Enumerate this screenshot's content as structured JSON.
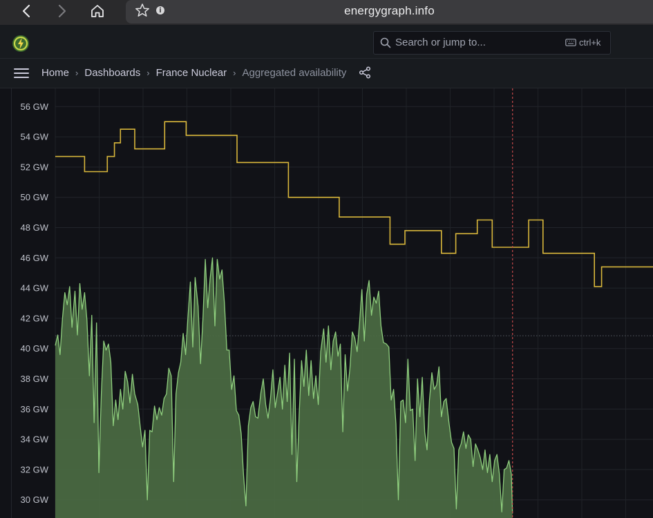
{
  "browser": {
    "url": "energygraph.info",
    "back_icon": "chevron-left-icon",
    "forward_icon": "chevron-right-icon",
    "home_icon": "home-icon"
  },
  "topbar": {
    "search_placeholder": "Search or jump to...",
    "shortcut": "ctrl+k"
  },
  "breadcrumb": {
    "items": [
      "Home",
      "Dashboards",
      "France Nuclear",
      "Aggregated availability"
    ]
  },
  "colors": {
    "availability_line": "#d9b73b",
    "production_fill": "#4b6b43",
    "production_line": "#8fcf7e",
    "now_marker": "#c84a4a"
  },
  "chart_data": {
    "type": "line",
    "y_unit": "GW",
    "yticks": [
      "56 GW",
      "54 GW",
      "52 GW",
      "50 GW",
      "48 GW",
      "46 GW",
      "44 GW",
      "42 GW",
      "40 GW",
      "38 GW",
      "36 GW",
      "34 GW",
      "32 GW",
      "30 GW"
    ],
    "ylim": [
      28.8,
      57.2
    ],
    "xlim": [
      0,
      100
    ],
    "grid": true,
    "threshold_line": 40.85,
    "now_marker_x": 76.5,
    "series": [
      {
        "style": "step",
        "points": [
          [
            0,
            52.7
          ],
          [
            4.9,
            52.7
          ],
          [
            4.9,
            51.7
          ],
          [
            8.7,
            51.7
          ],
          [
            8.7,
            52.7
          ],
          [
            9.9,
            52.7
          ],
          [
            9.9,
            53.6
          ],
          [
            10.9,
            53.6
          ],
          [
            10.9,
            54.5
          ],
          [
            13.3,
            54.5
          ],
          [
            13.3,
            53.2
          ],
          [
            18.3,
            53.2
          ],
          [
            18.3,
            55.0
          ],
          [
            21.9,
            55.0
          ],
          [
            21.9,
            54.1
          ],
          [
            30.4,
            54.1
          ],
          [
            30.4,
            52.3
          ],
          [
            39.0,
            52.3
          ],
          [
            39.0,
            50.0
          ],
          [
            47.5,
            50.0
          ],
          [
            47.5,
            48.7
          ],
          [
            56.0,
            48.7
          ],
          [
            56.0,
            46.9
          ],
          [
            58.5,
            46.9
          ],
          [
            58.5,
            47.8
          ],
          [
            64.6,
            47.8
          ],
          [
            64.6,
            46.3
          ],
          [
            67.0,
            46.3
          ],
          [
            67.0,
            47.6
          ],
          [
            70.6,
            47.6
          ],
          [
            70.6,
            48.5
          ],
          [
            73.1,
            48.5
          ],
          [
            73.1,
            46.7
          ],
          [
            79.2,
            46.7
          ],
          [
            79.2,
            48.5
          ],
          [
            81.6,
            48.5
          ],
          [
            81.6,
            46.3
          ],
          [
            90.2,
            46.3
          ],
          [
            90.2,
            44.1
          ],
          [
            91.4,
            44.1
          ],
          [
            91.4,
            45.4
          ],
          [
            100,
            45.4
          ]
        ]
      },
      {
        "style": "area",
        "points": [
          [
            0,
            40.2
          ],
          [
            0.4,
            40.9
          ],
          [
            0.8,
            39.6
          ],
          [
            1.2,
            42.0
          ],
          [
            1.6,
            43.7
          ],
          [
            2.0,
            42.9
          ],
          [
            2.4,
            44.1
          ],
          [
            2.8,
            41.4
          ],
          [
            3.3,
            43.8
          ],
          [
            3.7,
            40.9
          ],
          [
            4.1,
            44.3
          ],
          [
            4.5,
            42.6
          ],
          [
            4.9,
            43.7
          ],
          [
            5.3,
            41.9
          ],
          [
            5.7,
            38.2
          ],
          [
            6.1,
            42.2
          ],
          [
            6.5,
            35.1
          ],
          [
            6.9,
            41.7
          ],
          [
            7.3,
            31.8
          ],
          [
            7.7,
            37.0
          ],
          [
            8.1,
            40.5
          ],
          [
            8.5,
            39.9
          ],
          [
            8.9,
            40.3
          ],
          [
            9.3,
            39.1
          ],
          [
            9.7,
            34.9
          ],
          [
            10.1,
            36.6
          ],
          [
            10.5,
            35.3
          ],
          [
            10.9,
            37.3
          ],
          [
            11.3,
            36.0
          ],
          [
            11.7,
            38.5
          ],
          [
            12.1,
            37.8
          ],
          [
            12.5,
            36.4
          ],
          [
            12.9,
            38.3
          ],
          [
            13.3,
            37.0
          ],
          [
            13.8,
            36.3
          ],
          [
            14.2,
            34.9
          ],
          [
            14.6,
            33.5
          ],
          [
            15.0,
            34.6
          ],
          [
            15.4,
            30.0
          ],
          [
            15.8,
            34.6
          ],
          [
            16.2,
            34.5
          ],
          [
            16.6,
            36.2
          ],
          [
            17.0,
            35.3
          ],
          [
            17.4,
            36.1
          ],
          [
            17.8,
            35.6
          ],
          [
            18.2,
            36.7
          ],
          [
            18.6,
            37.0
          ],
          [
            19.0,
            38.7
          ],
          [
            19.4,
            38.2
          ],
          [
            19.8,
            31.2
          ],
          [
            20.2,
            37.0
          ],
          [
            20.6,
            38.4
          ],
          [
            21.0,
            39.1
          ],
          [
            21.4,
            41.0
          ],
          [
            21.8,
            39.6
          ],
          [
            22.2,
            42.1
          ],
          [
            22.6,
            44.4
          ],
          [
            23.0,
            40.1
          ],
          [
            23.4,
            44.7
          ],
          [
            23.9,
            42.8
          ],
          [
            24.3,
            39.0
          ],
          [
            24.7,
            42.0
          ],
          [
            25.1,
            45.9
          ],
          [
            25.5,
            42.7
          ],
          [
            25.9,
            44.6
          ],
          [
            26.3,
            46.0
          ],
          [
            26.7,
            41.5
          ],
          [
            27.1,
            45.9
          ],
          [
            27.5,
            44.6
          ],
          [
            27.9,
            45.2
          ],
          [
            28.3,
            43.0
          ],
          [
            28.7,
            39.9
          ],
          [
            29.1,
            39.9
          ],
          [
            29.5,
            37.3
          ],
          [
            29.9,
            38.2
          ],
          [
            30.3,
            35.9
          ],
          [
            30.7,
            35.6
          ],
          [
            31.1,
            34.4
          ],
          [
            31.5,
            31.6
          ],
          [
            31.9,
            29.6
          ],
          [
            32.3,
            34.9
          ],
          [
            32.7,
            36.1
          ],
          [
            33.1,
            36.5
          ],
          [
            33.5,
            35.5
          ],
          [
            33.9,
            35.4
          ],
          [
            34.4,
            37.1
          ],
          [
            34.8,
            38.0
          ],
          [
            35.2,
            36.3
          ],
          [
            35.6,
            35.4
          ],
          [
            36.0,
            36.7
          ],
          [
            36.4,
            38.6
          ],
          [
            36.8,
            36.1
          ],
          [
            37.2,
            37.1
          ],
          [
            37.6,
            38.1
          ],
          [
            38.0,
            36.0
          ],
          [
            38.4,
            38.9
          ],
          [
            38.8,
            36.5
          ],
          [
            39.2,
            39.7
          ],
          [
            39.6,
            33.0
          ],
          [
            40.0,
            39.3
          ],
          [
            40.4,
            31.2
          ],
          [
            40.8,
            35.6
          ],
          [
            41.2,
            39.2
          ],
          [
            41.6,
            37.5
          ],
          [
            42.0,
            39.9
          ],
          [
            42.4,
            36.9
          ],
          [
            42.8,
            39.2
          ],
          [
            43.2,
            36.7
          ],
          [
            43.6,
            38.2
          ],
          [
            44.0,
            36.3
          ],
          [
            44.4,
            39.8
          ],
          [
            44.9,
            41.3
          ],
          [
            45.3,
            39.1
          ],
          [
            45.7,
            41.5
          ],
          [
            46.1,
            38.6
          ],
          [
            46.5,
            40.5
          ],
          [
            46.9,
            41.1
          ],
          [
            47.3,
            39.5
          ],
          [
            47.7,
            40.3
          ],
          [
            48.1,
            34.5
          ],
          [
            48.5,
            39.6
          ],
          [
            48.9,
            37.2
          ],
          [
            49.3,
            38.7
          ],
          [
            49.7,
            41.1
          ],
          [
            50.1,
            40.7
          ],
          [
            50.5,
            39.8
          ],
          [
            50.9,
            41.7
          ],
          [
            51.3,
            43.9
          ],
          [
            51.7,
            40.5
          ],
          [
            52.1,
            43.6
          ],
          [
            52.5,
            44.5
          ],
          [
            52.9,
            42.2
          ],
          [
            53.3,
            43.4
          ],
          [
            53.7,
            43.0
          ],
          [
            54.1,
            43.8
          ],
          [
            54.5,
            41.5
          ],
          [
            54.9,
            40.4
          ],
          [
            55.4,
            40.3
          ],
          [
            55.8,
            40.1
          ],
          [
            56.2,
            36.6
          ],
          [
            56.6,
            37.3
          ],
          [
            57.0,
            35.0
          ],
          [
            57.4,
            30.0
          ],
          [
            57.8,
            36.5
          ],
          [
            58.2,
            36.6
          ],
          [
            58.6,
            35.1
          ],
          [
            59.0,
            39.3
          ],
          [
            59.4,
            35.9
          ],
          [
            59.8,
            36.0
          ],
          [
            60.2,
            32.6
          ],
          [
            60.6,
            38.0
          ],
          [
            61.0,
            35.5
          ],
          [
            61.4,
            38.1
          ],
          [
            61.8,
            34.5
          ],
          [
            62.2,
            33.3
          ],
          [
            62.6,
            36.6
          ],
          [
            63.0,
            38.4
          ],
          [
            63.4,
            37.3
          ],
          [
            63.8,
            37.6
          ],
          [
            64.2,
            38.8
          ],
          [
            64.6,
            35.5
          ],
          [
            65.0,
            36.5
          ],
          [
            65.4,
            36.7
          ],
          [
            65.9,
            35.0
          ],
          [
            66.3,
            33.8
          ],
          [
            66.7,
            33.4
          ],
          [
            67.1,
            29.4
          ],
          [
            67.5,
            33.3
          ],
          [
            67.9,
            33.7
          ],
          [
            68.3,
            34.5
          ],
          [
            68.7,
            33.4
          ],
          [
            69.1,
            34.3
          ],
          [
            69.5,
            34.0
          ],
          [
            69.9,
            32.2
          ],
          [
            70.3,
            33.7
          ],
          [
            70.7,
            33.3
          ],
          [
            71.1,
            32.8
          ],
          [
            71.5,
            32.0
          ],
          [
            71.9,
            33.3
          ],
          [
            72.3,
            31.8
          ],
          [
            72.7,
            33.0
          ],
          [
            73.1,
            31.2
          ],
          [
            73.5,
            32.6
          ],
          [
            73.9,
            33.0
          ],
          [
            74.3,
            31.7
          ],
          [
            74.7,
            29.2
          ],
          [
            75.1,
            32.0
          ],
          [
            75.5,
            32.1
          ],
          [
            75.9,
            32.6
          ],
          [
            76.3,
            31.7
          ],
          [
            76.5,
            29.1
          ]
        ]
      }
    ]
  }
}
